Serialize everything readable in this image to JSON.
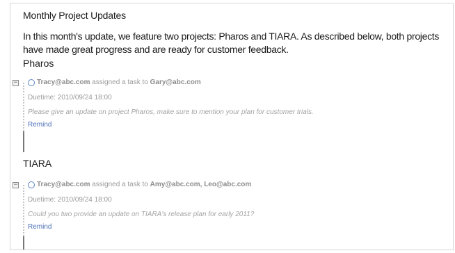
{
  "document": {
    "title": "Monthly Project Updates",
    "intro": "In this month's update, we feature two projects: Pharos and TIARA. As described below, both projects\nhave made great progress and are ready for customer feedback."
  },
  "projects": [
    {
      "name": "Pharos",
      "task": {
        "assigner": "Tracy@abc.com",
        "assigned_text": " assigned a task to ",
        "assignees": "Gary@abc.com",
        "duetime": "Duetime: 2010/09/24 18:00",
        "description": "Please give an update on project Pharos, make sure to mention your plan for customer trials.",
        "remind_label": "Remind",
        "collapse_glyph": "−"
      }
    },
    {
      "name": "TIARA",
      "task": {
        "assigner": "Tracy@abc.com",
        "assigned_text": " assigned a task to ",
        "assignees": "Amy@abc.com, Leo@abc.com",
        "duetime": "Duetime: 2010/09/24 18:00",
        "description": "Could you two provide an update on TIARA's release plan for early 2011?",
        "remind_label": "Remind",
        "collapse_glyph": "−"
      }
    }
  ],
  "icons": {
    "collapse": "minus-box-icon",
    "status": "circle-status-icon"
  },
  "colors": {
    "link": "#4b6fb8",
    "status_circle": "#5a84c4",
    "muted_text": "#9a9a9a"
  }
}
